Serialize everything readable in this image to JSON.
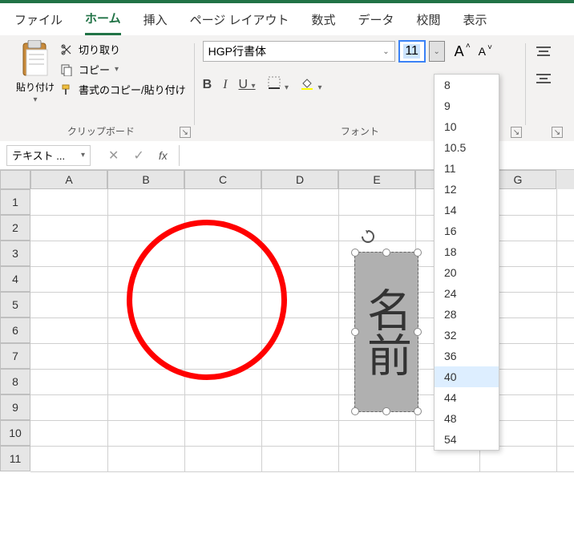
{
  "tabs": {
    "file": "ファイル",
    "home": "ホーム",
    "insert": "挿入",
    "page_layout": "ページ レイアウト",
    "formulas": "数式",
    "data": "データ",
    "review": "校閲",
    "view": "表示"
  },
  "clipboard": {
    "paste": "貼り付け",
    "cut": "切り取り",
    "copy": "コピー",
    "format_painter": "書式のコピー/貼り付け",
    "group_label": "クリップボード"
  },
  "font": {
    "name": "HGP行書体",
    "size": "11",
    "group_label": "フォント"
  },
  "name_box": "テキスト ...",
  "columns": [
    "A",
    "B",
    "C",
    "D",
    "E",
    "",
    "G"
  ],
  "rows": [
    "1",
    "2",
    "3",
    "4",
    "5",
    "6",
    "7",
    "8",
    "9",
    "10",
    "11"
  ],
  "shape_text": "名前",
  "size_options": [
    "8",
    "9",
    "10",
    "10.5",
    "11",
    "12",
    "14",
    "16",
    "18",
    "20",
    "24",
    "28",
    "32",
    "36",
    "40",
    "44",
    "48",
    "54"
  ],
  "size_highlight": "40"
}
